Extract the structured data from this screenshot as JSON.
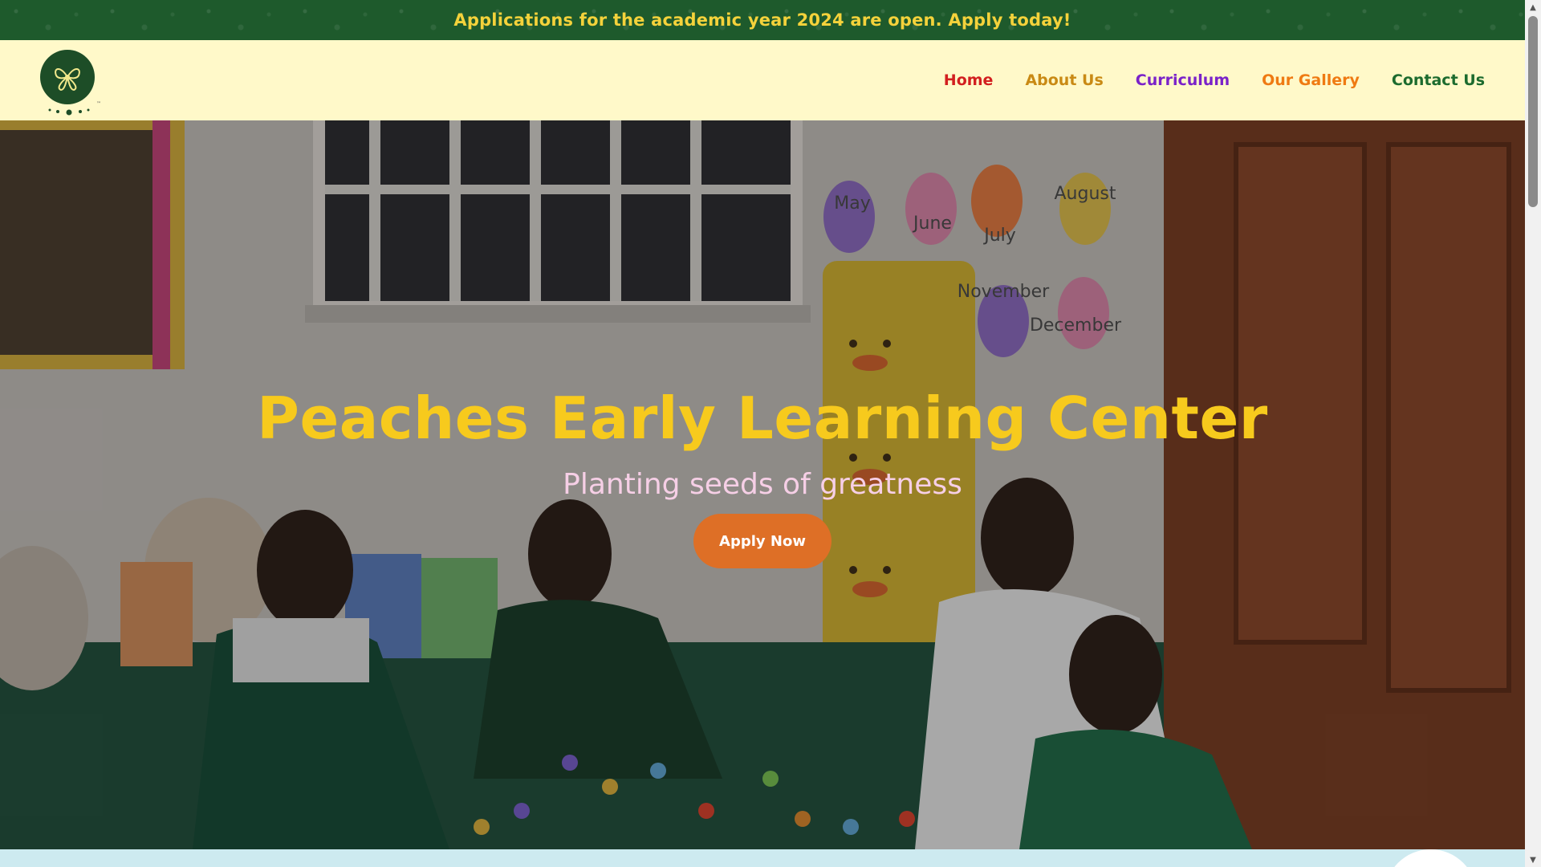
{
  "announcement": {
    "text": "Applications for the academic year 2024 are open. Apply today!"
  },
  "header": {
    "logo_icon": "butterfly-logo-icon",
    "nav": [
      {
        "label": "Home",
        "color": "#d21f1f"
      },
      {
        "label": "About Us",
        "color": "#c98a14"
      },
      {
        "label": "Curriculum",
        "color": "#7a22c9"
      },
      {
        "label": "Our Gallery",
        "color": "#ef7a12"
      },
      {
        "label": "Contact Us",
        "color": "#1c6b2e"
      }
    ]
  },
  "hero": {
    "title": "Peaches Early Learning Center",
    "subtitle": "Planting seeds of greatness",
    "cta_label": "Apply Now",
    "wall_months": [
      "May",
      "June",
      "July",
      "August",
      "November",
      "December"
    ]
  },
  "colors": {
    "brand_green": "#1e5a2c",
    "header_bg": "#fff9c9",
    "title_yellow": "#f7ca1d",
    "subtitle_pink": "#f6cfe6",
    "cta_orange": "#de6f26"
  }
}
